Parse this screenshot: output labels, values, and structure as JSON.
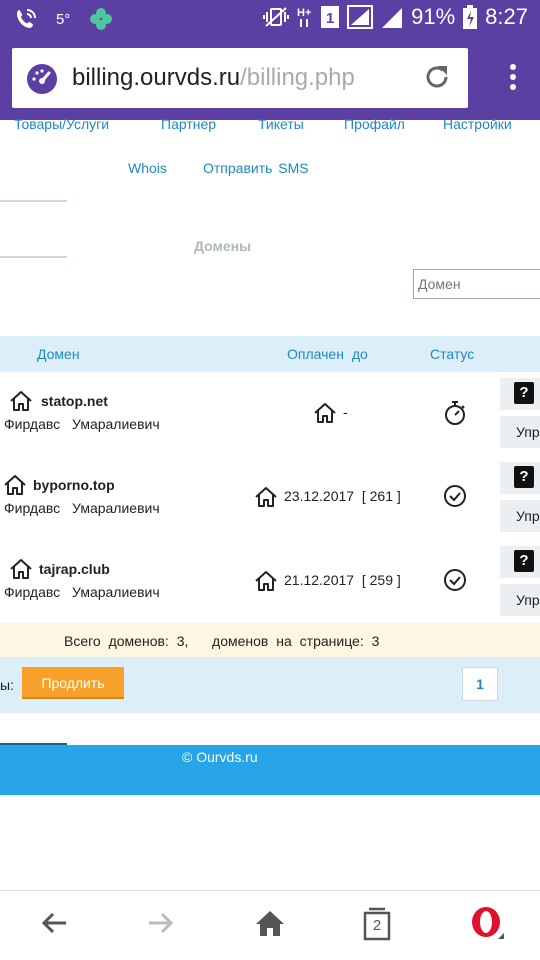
{
  "status_bar": {
    "temperature": "5°",
    "sim_slot": "1",
    "battery_percent": "91%",
    "time": "8:27"
  },
  "browser": {
    "url_host": "billing.ourvds.ru",
    "url_path": "/billing.php",
    "tabs_count": "2"
  },
  "nav": {
    "row1": [
      "Товары/Услуги",
      "Партнер",
      "Тикеты",
      "Профайл",
      "Настройки"
    ],
    "whois": "Whois",
    "send_sms": "Отправить  SMS"
  },
  "section_title": "Домены",
  "filter": {
    "placeholder": "Домен"
  },
  "table": {
    "headers": {
      "domain": "Домен",
      "paid_until": "Оплачен  до",
      "status": "Статус"
    },
    "rows": [
      {
        "domain": "statop.net",
        "owner": "Фирдавс Умаралиевич",
        "paid_until": "-",
        "status": "pending",
        "manage": "Упр"
      },
      {
        "domain": "byporno.top",
        "owner": "Фирдавс Умаралиевич",
        "paid_until": "23.12.2017  [ 261 ]",
        "status": "active",
        "manage": "Упр"
      },
      {
        "domain": "tajrap.club",
        "owner": "Фирдавс Умаралиевич",
        "paid_until": "21.12.2017  [ 259 ]",
        "status": "active",
        "manage": "Упр"
      }
    ]
  },
  "summary": "Всего доменов: 3,   доменов на странице: 3",
  "actions": {
    "label": "ы:",
    "renew_button": "Продлить",
    "current_page": "1"
  },
  "footer": {
    "copyright": "© Ourvds.ru"
  },
  "colors": {
    "toolbar": "#5b3fa3",
    "link": "#1e88c8",
    "footer": "#27a5e8",
    "renew": "#f7a12a"
  }
}
